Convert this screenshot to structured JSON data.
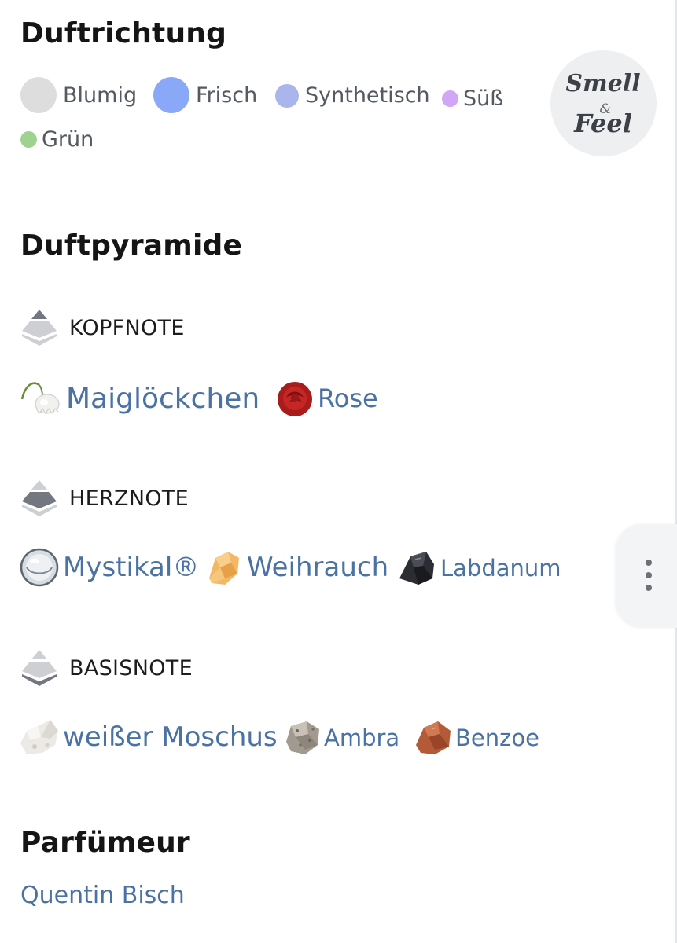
{
  "scent_direction": {
    "title": "Duftrichtung",
    "chips": [
      {
        "label": "Blumig",
        "color": "#dddddd"
      },
      {
        "label": "Frisch",
        "color": "#8aa8f8"
      },
      {
        "label": "Synthetisch",
        "color": "#aab5ec"
      },
      {
        "label": "Süß",
        "color": "#d2a6f6"
      },
      {
        "label": "Grün",
        "color": "#9fd18f"
      }
    ]
  },
  "logo": {
    "line1": "Smell",
    "amp": "&",
    "line2": "Feel"
  },
  "pyramid": {
    "title": "Duftpyramide",
    "top": {
      "label": "KOPFNOTE",
      "icon": "pyramid-top-icon",
      "ingredients": [
        {
          "name": "Maiglöckchen",
          "icon": "lily-of-the-valley-icon"
        },
        {
          "name": "Rose",
          "icon": "rose-icon"
        }
      ]
    },
    "heart": {
      "label": "HERZNOTE",
      "icon": "pyramid-middle-icon",
      "ingredients": [
        {
          "name": "Mystikal®",
          "icon": "drop-icon"
        },
        {
          "name": "Weihrauch",
          "icon": "frankincense-icon"
        },
        {
          "name": "Labdanum",
          "icon": "labdanum-icon"
        }
      ]
    },
    "base": {
      "label": "BASISNOTE",
      "icon": "pyramid-base-icon",
      "ingredients": [
        {
          "name": "weißer Moschus",
          "icon": "white-musk-icon"
        },
        {
          "name": "Ambra",
          "icon": "ambra-icon"
        },
        {
          "name": "Benzoe",
          "icon": "benzoe-icon"
        }
      ]
    }
  },
  "perfumer": {
    "title": "Parfümeur",
    "name": "Quentin Bisch"
  },
  "accent_colors": {
    "link": "#4a72a3",
    "pyramid_dark": "#74777f",
    "pyramid_light": "#cdcfd3"
  }
}
